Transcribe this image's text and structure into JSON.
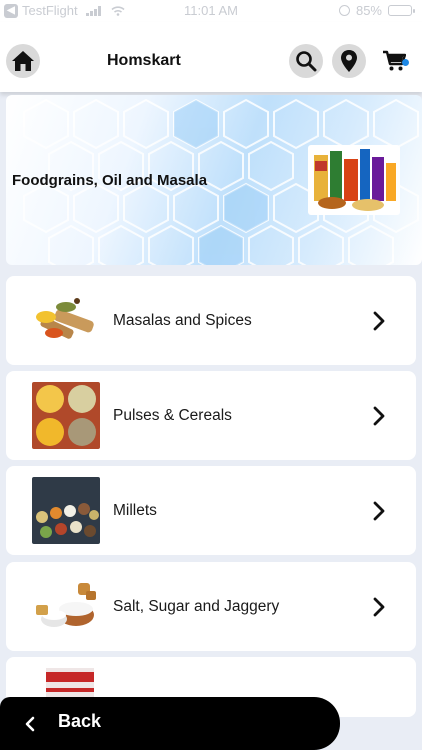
{
  "status_bar": {
    "carrier": "TestFlight",
    "time": "11:01 AM",
    "battery": "85%",
    "battery_level": 0.85
  },
  "header": {
    "title": "Homskart",
    "cart_badge_color": "#1e88e5"
  },
  "banner": {
    "title": "Foodgrains, Oil and Masala"
  },
  "categories": [
    {
      "label": "Masalas and Spices",
      "icon": "spices-image"
    },
    {
      "label": "Pulses & Cereals",
      "icon": "pulses-image"
    },
    {
      "label": "Millets",
      "icon": "millets-image"
    },
    {
      "label": "Salt, Sugar and Jaggery",
      "icon": "salt-sugar-image"
    },
    {
      "label": "",
      "icon": "packet-image"
    }
  ],
  "footer": {
    "back_label": "Back"
  }
}
